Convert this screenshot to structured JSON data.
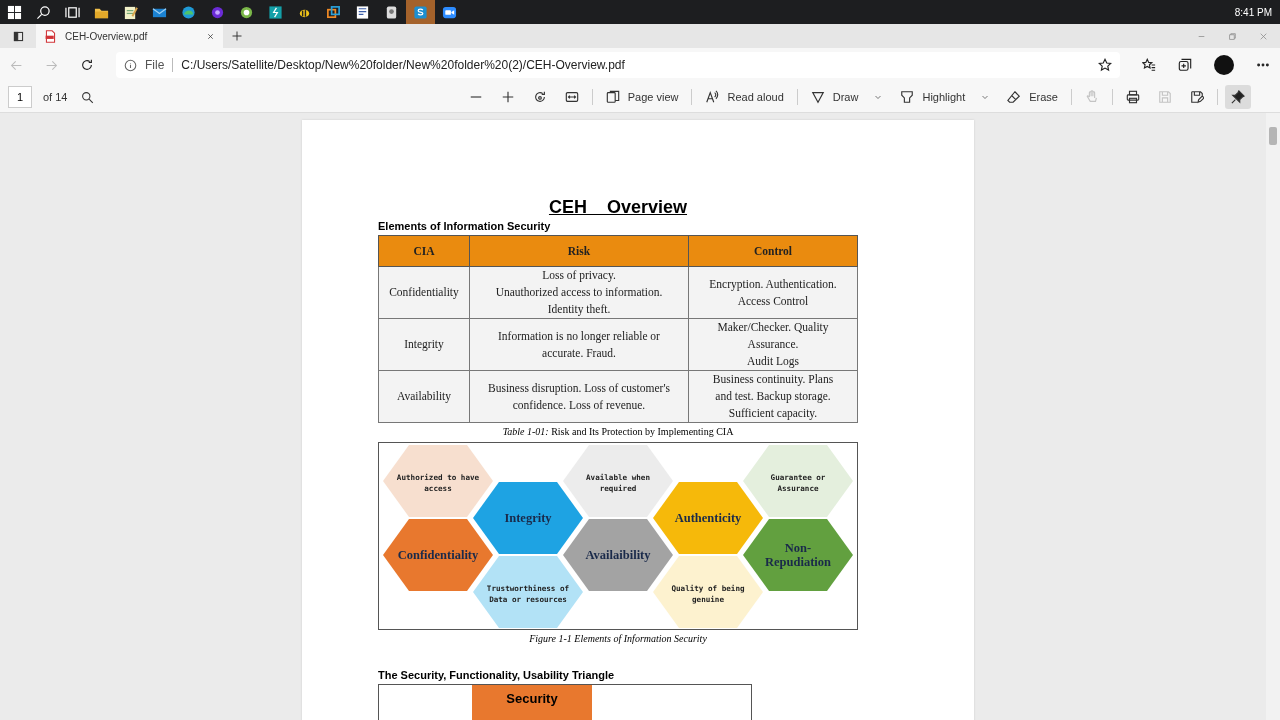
{
  "taskbar": {
    "apps": [
      {
        "kind": "start",
        "selected": false
      },
      {
        "kind": "search",
        "selected": false
      },
      {
        "kind": "taskview",
        "selected": false
      },
      {
        "kind": "folder",
        "selected": false
      },
      {
        "kind": "notepad",
        "selected": false
      },
      {
        "kind": "mail",
        "selected": false
      },
      {
        "kind": "edge",
        "selected": false
      },
      {
        "kind": "purple",
        "selected": false
      },
      {
        "kind": "green",
        "selected": false
      },
      {
        "kind": "teal",
        "selected": false
      },
      {
        "kind": "bee",
        "selected": false
      },
      {
        "kind": "squares",
        "selected": false
      },
      {
        "kind": "doc",
        "selected": false
      },
      {
        "kind": "drive",
        "selected": false
      },
      {
        "kind": "skype",
        "selected": true
      },
      {
        "kind": "camera",
        "selected": false
      }
    ],
    "clock": "8:41 PM"
  },
  "tabs": [
    {
      "title": "CEH-Overview.pdf",
      "selected": true
    }
  ],
  "address_bar": {
    "scheme": "File",
    "url": "C:/Users/Satellite/Desktop/New%20folder/New%20folder%20(2)/CEH-Overview.pdf"
  },
  "pdf_toolbar": {
    "page": "1",
    "page_count": "of 14",
    "tools": [
      {
        "kind": "zoom-out",
        "disabled": false,
        "selected": false
      },
      {
        "kind": "zoom-in",
        "disabled": false,
        "selected": false
      },
      {
        "kind": "rotate",
        "disabled": false,
        "selected": false
      },
      {
        "kind": "fit",
        "disabled": false,
        "selected": false
      },
      {
        "kind": "separator"
      },
      {
        "kind": "page-view",
        "label": "Page view",
        "disabled": false,
        "selected": false
      },
      {
        "kind": "separator"
      },
      {
        "kind": "read-aloud",
        "label": "Read aloud",
        "disabled": false,
        "selected": false
      },
      {
        "kind": "separator"
      },
      {
        "kind": "draw",
        "label": "Draw",
        "dropdown": true,
        "disabled": false,
        "selected": false
      },
      {
        "kind": "highlight",
        "label": "Highlight",
        "dropdown": true,
        "disabled": false,
        "selected": false
      },
      {
        "kind": "erase",
        "label": "Erase",
        "disabled": false,
        "selected": false
      },
      {
        "kind": "separator"
      },
      {
        "kind": "touch",
        "disabled": true,
        "selected": false
      },
      {
        "kind": "separator"
      },
      {
        "kind": "print",
        "disabled": false,
        "selected": false
      },
      {
        "kind": "save",
        "disabled": true,
        "selected": false
      },
      {
        "kind": "save-as",
        "disabled": false,
        "selected": false
      },
      {
        "kind": "separator"
      },
      {
        "kind": "pin",
        "disabled": false,
        "selected": true
      }
    ]
  },
  "document": {
    "title": "CEH _ Overview",
    "section_heading": "Elements of Information Security",
    "table": {
      "columns": [
        "CIA",
        "Risk",
        "Control"
      ],
      "rows": [
        [
          "Confidentiality",
          "Loss of privacy.\nUnauthorized access to information.\nIdentity theft.",
          "Encryption. Authentication.\nAccess Control"
        ],
        [
          "Integrity",
          "Information is no longer reliable or\naccurate. Fraud.",
          "Maker/Checker. Quality\nAssurance.\nAudit Logs"
        ],
        [
          "Availability",
          "Business disruption. Loss of customer's\nconfidence. Loss of revenue.",
          "Business continuity. Plans\nand test. Backup storage.\nSufficient capacity."
        ]
      ]
    },
    "table_caption": "*Table 1-01:* Risk and Its Protection by Implementing CIA",
    "figure": {
      "hexagons": [
        {
          "label": "Authorized to have\naccess",
          "kind": "description",
          "color": "#f7dfcf"
        },
        {
          "label": "Available when\nrequired",
          "kind": "description",
          "color": "#ececec"
        },
        {
          "label": "Guarantee or\nAssurance",
          "kind": "description",
          "color": "#e4efdd"
        },
        {
          "label": "Integrity",
          "kind": "term",
          "color": "#1ea3e3"
        },
        {
          "label": "Authenticity",
          "kind": "term",
          "color": "#f6b90a"
        },
        {
          "label": "Confidentiality",
          "kind": "term",
          "color": "#e8782e"
        },
        {
          "label": "Availaibility",
          "kind": "term",
          "color": "#a3a3a3"
        },
        {
          "label": "Non-\nRepudiation",
          "kind": "term",
          "color": "#62a03f"
        },
        {
          "label": "Trustworthiness of\nData or resources",
          "kind": "description",
          "color": "#b2e2f6"
        },
        {
          "label": "Quality of being\ngenuine",
          "kind": "description",
          "color": "#fdf2cf"
        }
      ],
      "caption": "Figure 1-1 Elements of Information Security"
    },
    "second_heading": "The Security, Functionality, Usability Triangle",
    "triangle": {
      "top_label": "Security"
    }
  }
}
